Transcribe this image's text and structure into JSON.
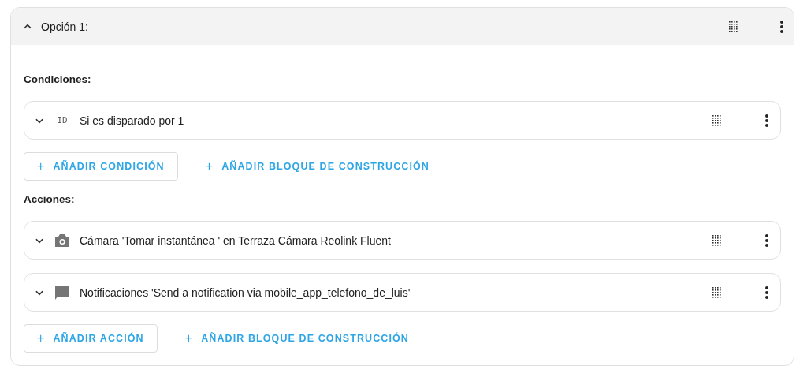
{
  "option": {
    "title": "Opción 1:",
    "expanded": true
  },
  "sections": [
    {
      "heading": "Condiciones:",
      "rows": [
        {
          "kind": "id",
          "icon_text": "ID",
          "label": "Si es disparado por 1",
          "expanded": false
        }
      ],
      "buttons": [
        {
          "label": "AÑADIR CONDICIÓN",
          "outlined": true,
          "icon_text": "+"
        },
        {
          "label": "AÑADIR BLOQUE DE CONSTRUCCIÓN",
          "outlined": false,
          "icon_text": "+"
        }
      ]
    },
    {
      "heading": "Acciones:",
      "rows": [
        {
          "kind": "camera",
          "label": "Cámara 'Tomar instantánea ' en Terraza Cámara Reolink Fluent",
          "expanded": false
        },
        {
          "kind": "message",
          "label": "Notificaciones 'Send a notification via mobile_app_telefono_de_luis'",
          "expanded": false
        }
      ],
      "buttons": [
        {
          "label": "AÑADIR ACCIÓN",
          "outlined": true,
          "icon_text": "+"
        },
        {
          "label": "AÑADIR BLOQUE DE CONSTRUCCIÓN",
          "outlined": false,
          "icon_text": "+"
        }
      ]
    }
  ]
}
